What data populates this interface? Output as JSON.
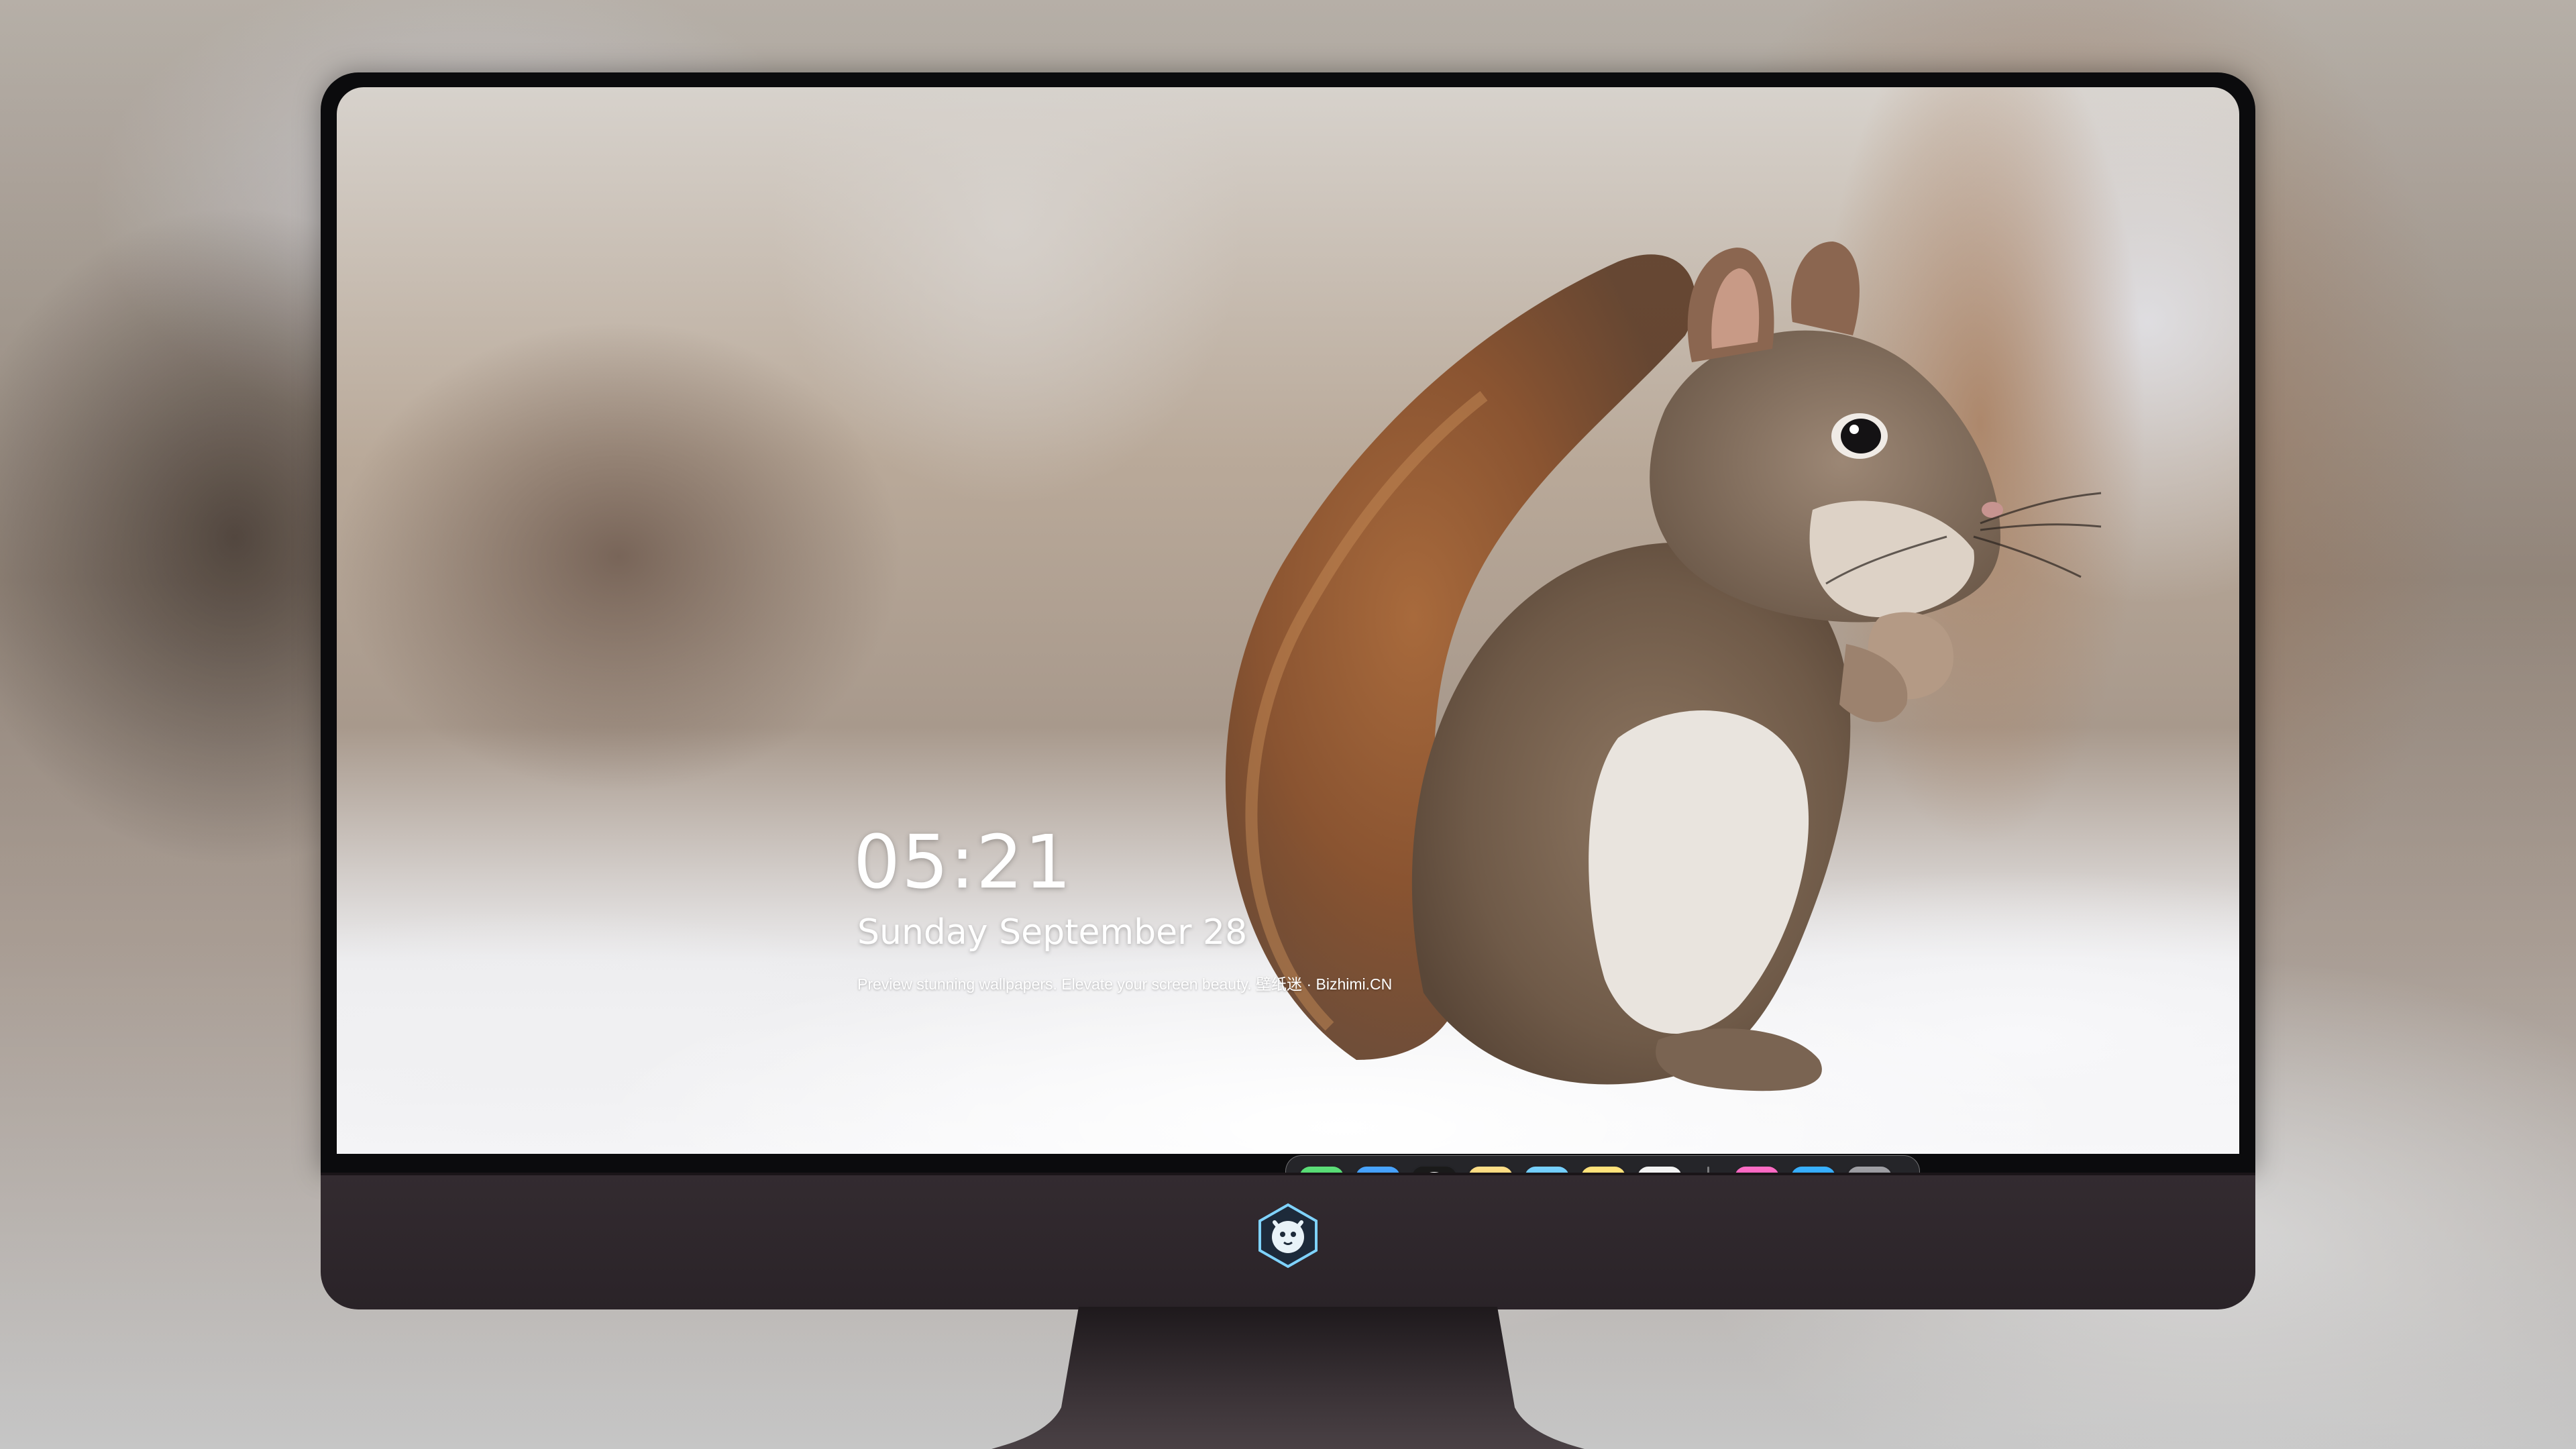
{
  "lockscreen": {
    "time": "05:21",
    "date": "Sunday September  28",
    "tagline": "Preview stunning wallpapers. Elevate your screen beauty. 壁纸迷 · Bizhimi.CN"
  },
  "dock": {
    "apps": [
      {
        "icon": "messages-icon",
        "color": "#34c759"
      },
      {
        "icon": "weather-icon",
        "color": "#2f8cf5"
      },
      {
        "icon": "clock-icon",
        "color": "#ffffff"
      },
      {
        "icon": "preview-icon",
        "color": "#f3c845"
      },
      {
        "icon": "clips-icon",
        "color": "#5ac8fa"
      },
      {
        "icon": "notes-icon",
        "color": "#ffd54a"
      },
      {
        "icon": "photo-booth-icon",
        "color": "#e8e8e8"
      },
      {
        "icon": "music-icon",
        "color": "#f54fa6"
      },
      {
        "icon": "app-store-icon",
        "color": "#1d8cf8"
      },
      {
        "icon": "camera-icon",
        "color": "#8e8e93"
      }
    ]
  },
  "monitor": {
    "bezel_color": "#0b0b0d",
    "chin_color": "#2d2529"
  }
}
